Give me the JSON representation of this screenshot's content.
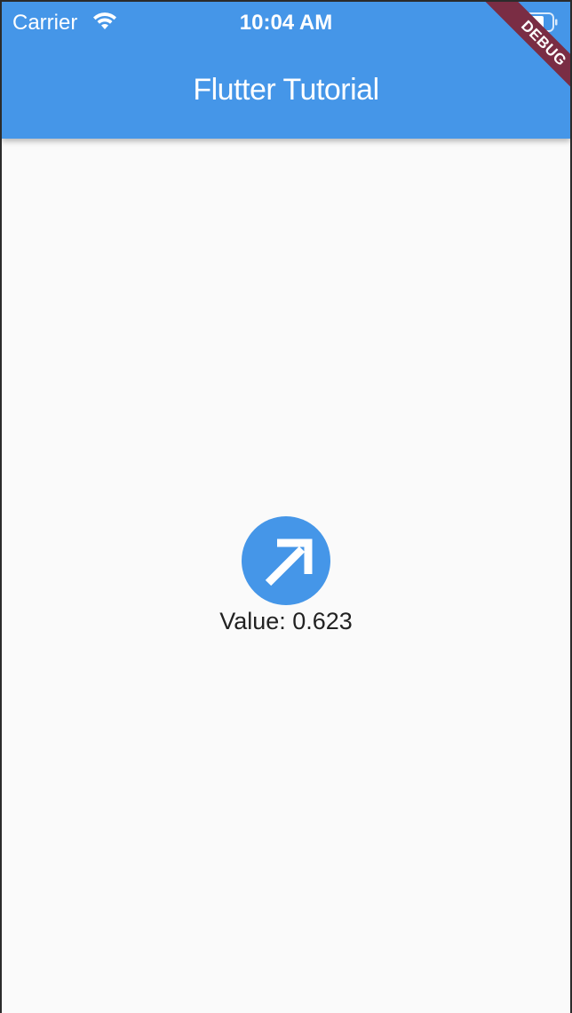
{
  "status_bar": {
    "carrier": "Carrier",
    "time": "10:04 AM",
    "wifi_icon": "wifi-icon",
    "battery_icon": "battery-icon"
  },
  "app_bar": {
    "title": "Flutter Tutorial",
    "background": "#4596e8"
  },
  "debug_banner": {
    "label": "DEBUG",
    "color": "#7a2d44"
  },
  "main": {
    "dial": {
      "icon": "arrow-up-right-icon",
      "color": "#4596e8"
    },
    "value_label": "Value: 0.623"
  }
}
